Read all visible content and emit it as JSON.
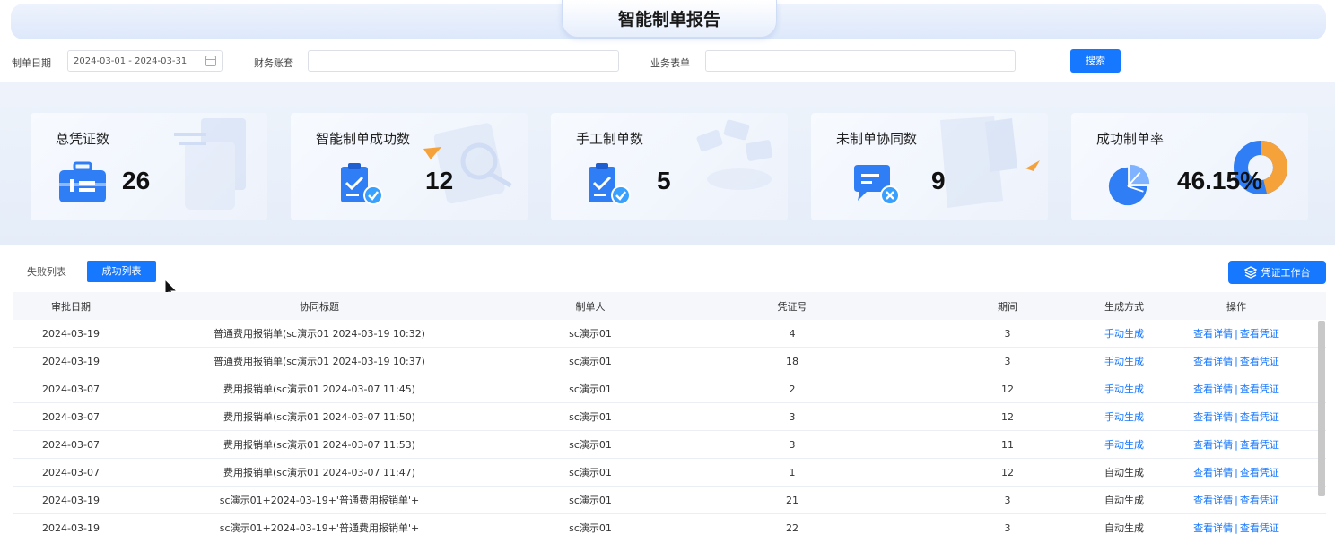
{
  "header": {
    "title": "智能制单报告"
  },
  "filters": {
    "date_label": "制单日期",
    "date_value": "2024-03-01 - 2024-03-31",
    "ledger_label": "财务账套",
    "ledger_value": "",
    "form_label": "业务表单",
    "form_value": "",
    "search_label": "搜索"
  },
  "stats": [
    {
      "title": "总凭证数",
      "value": "26",
      "icon": "briefcase-icon"
    },
    {
      "title": "智能制单成功数",
      "value": "12",
      "icon": "clipboard-check-icon"
    },
    {
      "title": "手工制单数",
      "value": "5",
      "icon": "clipboard-check-icon"
    },
    {
      "title": "未制单协同数",
      "value": "9",
      "icon": "message-cancel-icon"
    },
    {
      "title": "成功制单率",
      "value": "46.15%",
      "icon": "pie-chart-icon",
      "rate": 0.4615
    }
  ],
  "tabs": {
    "fail": "失败列表",
    "success": "成功列表",
    "active": "success"
  },
  "voucher_button": "凭证工作台",
  "table": {
    "columns": [
      "审批日期",
      "协同标题",
      "制单人",
      "凭证号",
      "期间",
      "生成方式",
      "操作"
    ],
    "rows": [
      {
        "date": "2024-03-19",
        "title": "普通费用报销单(sc演示01 2024-03-19 10:32)",
        "maker": "sc演示01",
        "voucher": "4",
        "period": "3",
        "mode": "手动生成",
        "manual": true
      },
      {
        "date": "2024-03-19",
        "title": "普通费用报销单(sc演示01 2024-03-19 10:37)",
        "maker": "sc演示01",
        "voucher": "18",
        "period": "3",
        "mode": "手动生成",
        "manual": true
      },
      {
        "date": "2024-03-07",
        "title": "费用报销单(sc演示01 2024-03-07 11:45)",
        "maker": "sc演示01",
        "voucher": "2",
        "period": "12",
        "mode": "手动生成",
        "manual": true
      },
      {
        "date": "2024-03-07",
        "title": "费用报销单(sc演示01 2024-03-07 11:50)",
        "maker": "sc演示01",
        "voucher": "3",
        "period": "12",
        "mode": "手动生成",
        "manual": true
      },
      {
        "date": "2024-03-07",
        "title": "费用报销单(sc演示01 2024-03-07 11:53)",
        "maker": "sc演示01",
        "voucher": "3",
        "period": "11",
        "mode": "手动生成",
        "manual": true
      },
      {
        "date": "2024-03-07",
        "title": "费用报销单(sc演示01 2024-03-07 11:47)",
        "maker": "sc演示01",
        "voucher": "1",
        "period": "12",
        "mode": "自动生成",
        "manual": false
      },
      {
        "date": "2024-03-19",
        "title": "sc演示01+2024-03-19+'普通费用报销单'+",
        "maker": "sc演示01",
        "voucher": "21",
        "period": "3",
        "mode": "自动生成",
        "manual": false
      },
      {
        "date": "2024-03-19",
        "title": "sc演示01+2024-03-19+'普通费用报销单'+",
        "maker": "sc演示01",
        "voucher": "22",
        "period": "3",
        "mode": "自动生成",
        "manual": false
      }
    ],
    "action_detail": "查看详情",
    "action_sep": "|",
    "action_voucher": "查看凭证"
  },
  "colors": {
    "primary": "#1677ff",
    "icon_blue": "#2f7ef5",
    "donut_orange": "#f5a23a"
  }
}
